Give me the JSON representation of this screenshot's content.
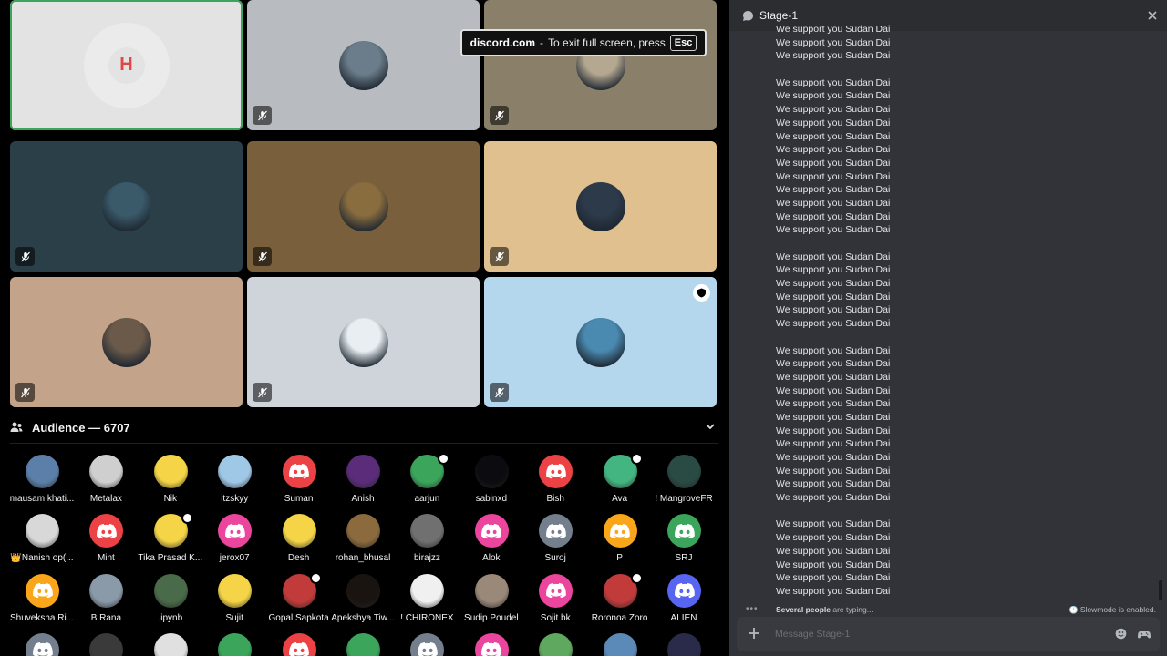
{
  "toast": {
    "domain": "discord.com",
    "text": "To exit full screen, press",
    "key": "Esc"
  },
  "speakers": [
    {
      "bg": "#e3e3e3",
      "active": true
    },
    {
      "bg": "#b8bcc0"
    },
    {
      "bg": "#8a8069"
    },
    {
      "bg": "#2b3f49"
    },
    {
      "bg": "#7a5f3c"
    },
    {
      "bg": "#dfc08e"
    },
    {
      "bg": "#c3a38a"
    },
    {
      "bg": "#cfd4da"
    },
    {
      "bg": "#b5d7ee",
      "shield": true
    }
  ],
  "audience": {
    "label": "Audience — 6707",
    "members": [
      {
        "name": "mausam khati...",
        "color": "#5b7fa8"
      },
      {
        "name": "Metalax",
        "color": "#cfcfcf"
      },
      {
        "name": "Nik",
        "color": "#f5d547"
      },
      {
        "name": "itzskyy",
        "color": "#9fc7e6"
      },
      {
        "name": "Suman",
        "color": "#ed4245",
        "discord": true
      },
      {
        "name": "Anish",
        "color": "#5a2c7a"
      },
      {
        "name": "aarjun",
        "color": "#3ba55c",
        "badge": true
      },
      {
        "name": "sabinxd",
        "color": "#0c0c10"
      },
      {
        "name": "Bish",
        "color": "#ed4245",
        "discord": true
      },
      {
        "name": "Ava",
        "color": "#43b581",
        "badge": true
      },
      {
        "name": "! MangroveFR",
        "color": "#2a4a44"
      },
      {
        "name": "👑Nanish op(...",
        "color": "#d8d8d8"
      },
      {
        "name": "Mint",
        "color": "#ed4245",
        "discord": true
      },
      {
        "name": "Tika Prasad K...",
        "color": "#f5d547",
        "badge": true
      },
      {
        "name": "jerox07",
        "color": "#eb459e",
        "discord": true
      },
      {
        "name": "Desh",
        "color": "#f5d547"
      },
      {
        "name": "rohan_bhusal",
        "color": "#8b6b3e"
      },
      {
        "name": "birajzz",
        "color": "#707070"
      },
      {
        "name": "Alok",
        "color": "#eb459e",
        "discord": true
      },
      {
        "name": "Suroj",
        "color": "#747f8d",
        "discord": true
      },
      {
        "name": "P",
        "color": "#faa61a",
        "discord": true
      },
      {
        "name": "SRJ",
        "color": "#3ba55c",
        "discord": true
      },
      {
        "name": "Shuveksha Ri...",
        "color": "#faa61a",
        "discord": true
      },
      {
        "name": "B.Rana",
        "color": "#8a9aa8"
      },
      {
        "name": ".ipynb",
        "color": "#4a6b4a"
      },
      {
        "name": "Sujit",
        "color": "#f5d547"
      },
      {
        "name": "Gopal Sapkota",
        "color": "#c23b3b",
        "badge": true
      },
      {
        "name": "Apekshya Tiw...",
        "color": "#1a1410"
      },
      {
        "name": "! CHIRONEX",
        "color": "#f0f0f0"
      },
      {
        "name": "Sudip Poudel",
        "color": "#9a8878"
      },
      {
        "name": "Sojit bk",
        "color": "#eb459e",
        "discord": true
      },
      {
        "name": "Roronoa Zoro",
        "color": "#c23b3b",
        "badge": true
      },
      {
        "name": "ALIEN",
        "color": "#5865f2",
        "discord": true
      },
      {
        "name": "",
        "color": "#747f8d",
        "discord": true
      },
      {
        "name": "",
        "color": "#3a3a3a"
      },
      {
        "name": "",
        "color": "#e0e0e0"
      },
      {
        "name": "",
        "color": "#3ba55c"
      },
      {
        "name": "",
        "color": "#ed4245",
        "discord": true
      },
      {
        "name": "",
        "color": "#3ba55c"
      },
      {
        "name": "",
        "color": "#747f8d",
        "discord": true
      },
      {
        "name": "",
        "color": "#eb459e",
        "discord": true
      },
      {
        "name": "",
        "color": "#5fa85f"
      },
      {
        "name": "",
        "color": "#5b8ab8"
      },
      {
        "name": "",
        "color": "#2a2a4a"
      }
    ]
  },
  "chat": {
    "title": "Stage-1",
    "message_text": "We support you Sudan Dai",
    "groups": [
      3,
      12,
      6,
      12,
      6
    ],
    "typing": "Several people are typing...",
    "slowmode": "Slowmode is enabled.",
    "placeholder": "Message Stage-1"
  }
}
